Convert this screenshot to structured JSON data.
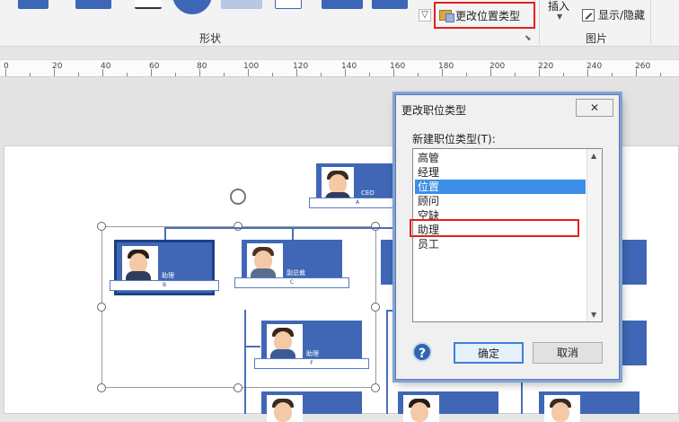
{
  "ribbon": {
    "change_position_type_label": "更改位置类型",
    "shapes_group_label": "形状",
    "insert_label": "插入",
    "show_hide_label": "显示/隐藏",
    "picture_group_label": "图片"
  },
  "ruler": {
    "ticks": [
      "0",
      "20",
      "40",
      "60",
      "80",
      "100",
      "120",
      "140",
      "160",
      "180",
      "200",
      "220",
      "240",
      "260"
    ]
  },
  "chart": {
    "cards": [
      {
        "role": "CEO",
        "letter": "A"
      },
      {
        "role": "助理",
        "letter": "B"
      },
      {
        "role": "副总裁",
        "letter": "C"
      },
      {
        "role": "助理",
        "letter": "F"
      }
    ]
  },
  "dialog": {
    "title": "更改职位类型",
    "close_label": "✕",
    "list_label": "新建职位类型(T):",
    "items": [
      "高管",
      "经理",
      "位置",
      "顾问",
      "空缺",
      "助理",
      "员工"
    ],
    "selected_index": 2,
    "help_label": "?",
    "ok_label": "确定",
    "cancel_label": "取消"
  }
}
